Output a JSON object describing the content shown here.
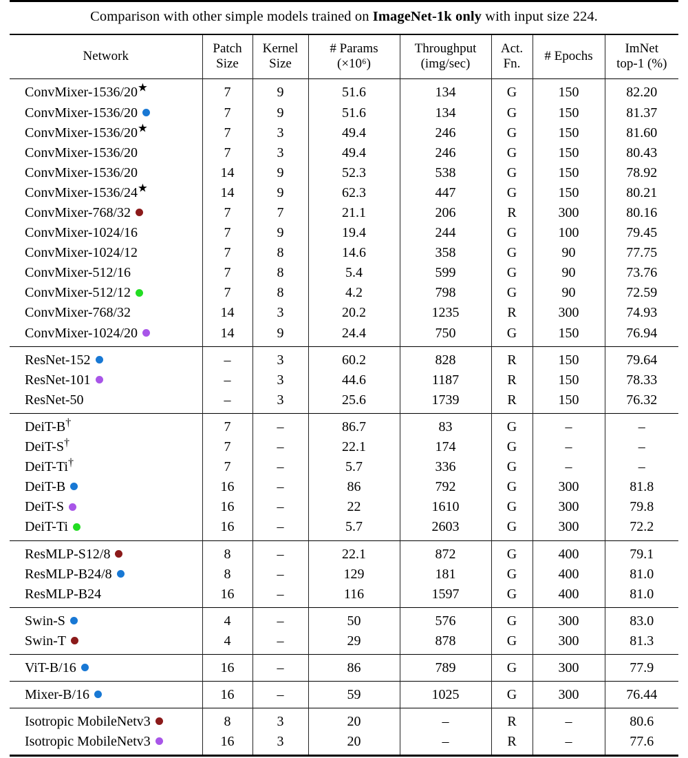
{
  "caption": {
    "prefix": "Comparison with other simple models trained on ",
    "bold": "ImageNet-1k only",
    "suffix": " with input size 224."
  },
  "columns": [
    {
      "id": "network",
      "line1": "Network",
      "line2": ""
    },
    {
      "id": "patch_size",
      "line1": "Patch",
      "line2": "Size"
    },
    {
      "id": "kernel_size",
      "line1": "Kernel",
      "line2": "Size"
    },
    {
      "id": "params",
      "line1": "# Params",
      "line2": "(×10⁶)"
    },
    {
      "id": "throughput",
      "line1": "Throughput",
      "line2": "(img/sec)"
    },
    {
      "id": "act_fn",
      "line1": "Act.",
      "line2": "Fn."
    },
    {
      "id": "epochs",
      "line1": "# Epochs",
      "line2": ""
    },
    {
      "id": "imnet_top1",
      "line1": "ImNet",
      "line2": "top-1 (%)"
    }
  ],
  "marker_colors": {
    "blue": "#1878D4",
    "darkred": "#8B1A1A",
    "green": "#22DD22",
    "purple": "#A855E8"
  },
  "groups": [
    {
      "id": "convmixer",
      "rows": [
        {
          "network": "ConvMixer-1536/20",
          "star": true,
          "dot": null,
          "patch_size": "7",
          "kernel_size": "9",
          "params": "51.6",
          "throughput": "134",
          "act_fn": "G",
          "epochs": "150",
          "imnet_top1": "82.20"
        },
        {
          "network": "ConvMixer-1536/20",
          "star": false,
          "dot": "blue",
          "patch_size": "7",
          "kernel_size": "9",
          "params": "51.6",
          "throughput": "134",
          "act_fn": "G",
          "epochs": "150",
          "imnet_top1": "81.37"
        },
        {
          "network": "ConvMixer-1536/20",
          "star": true,
          "dot": null,
          "patch_size": "7",
          "kernel_size": "3",
          "params": "49.4",
          "throughput": "246",
          "act_fn": "G",
          "epochs": "150",
          "imnet_top1": "81.60"
        },
        {
          "network": "ConvMixer-1536/20",
          "star": false,
          "dot": null,
          "patch_size": "7",
          "kernel_size": "3",
          "params": "49.4",
          "throughput": "246",
          "act_fn": "G",
          "epochs": "150",
          "imnet_top1": "80.43"
        },
        {
          "network": "ConvMixer-1536/20",
          "star": false,
          "dot": null,
          "patch_size": "14",
          "kernel_size": "9",
          "params": "52.3",
          "throughput": "538",
          "act_fn": "G",
          "epochs": "150",
          "imnet_top1": "78.92"
        },
        {
          "network": "ConvMixer-1536/24",
          "star": true,
          "dot": null,
          "patch_size": "14",
          "kernel_size": "9",
          "params": "62.3",
          "throughput": "447",
          "act_fn": "G",
          "epochs": "150",
          "imnet_top1": "80.21"
        },
        {
          "network": "ConvMixer-768/32",
          "star": false,
          "dot": "darkred",
          "patch_size": "7",
          "kernel_size": "7",
          "params": "21.1",
          "throughput": "206",
          "act_fn": "R",
          "epochs": "300",
          "imnet_top1": "80.16"
        },
        {
          "network": "ConvMixer-1024/16",
          "star": false,
          "dot": null,
          "patch_size": "7",
          "kernel_size": "9",
          "params": "19.4",
          "throughput": "244",
          "act_fn": "G",
          "epochs": "100",
          "imnet_top1": "79.45"
        },
        {
          "network": "ConvMixer-1024/12",
          "star": false,
          "dot": null,
          "patch_size": "7",
          "kernel_size": "8",
          "params": "14.6",
          "throughput": "358",
          "act_fn": "G",
          "epochs": "90",
          "imnet_top1": "77.75"
        },
        {
          "network": "ConvMixer-512/16",
          "star": false,
          "dot": null,
          "patch_size": "7",
          "kernel_size": "8",
          "params": "5.4",
          "throughput": "599",
          "act_fn": "G",
          "epochs": "90",
          "imnet_top1": "73.76"
        },
        {
          "network": "ConvMixer-512/12",
          "star": false,
          "dot": "green",
          "patch_size": "7",
          "kernel_size": "8",
          "params": "4.2",
          "throughput": "798",
          "act_fn": "G",
          "epochs": "90",
          "imnet_top1": "72.59"
        },
        {
          "network": "ConvMixer-768/32",
          "star": false,
          "dot": null,
          "patch_size": "14",
          "kernel_size": "3",
          "params": "20.2",
          "throughput": "1235",
          "act_fn": "R",
          "epochs": "300",
          "imnet_top1": "74.93"
        },
        {
          "network": "ConvMixer-1024/20",
          "star": false,
          "dot": "purple",
          "patch_size": "14",
          "kernel_size": "9",
          "params": "24.4",
          "throughput": "750",
          "act_fn": "G",
          "epochs": "150",
          "imnet_top1": "76.94"
        }
      ]
    },
    {
      "id": "resnet",
      "rows": [
        {
          "network": "ResNet-152",
          "star": false,
          "dot": "blue",
          "patch_size": "–",
          "kernel_size": "3",
          "params": "60.2",
          "throughput": "828",
          "act_fn": "R",
          "epochs": "150",
          "imnet_top1": "79.64"
        },
        {
          "network": "ResNet-101",
          "star": false,
          "dot": "purple",
          "patch_size": "–",
          "kernel_size": "3",
          "params": "44.6",
          "throughput": "1187",
          "act_fn": "R",
          "epochs": "150",
          "imnet_top1": "78.33"
        },
        {
          "network": "ResNet-50",
          "star": false,
          "dot": null,
          "patch_size": "–",
          "kernel_size": "3",
          "params": "25.6",
          "throughput": "1739",
          "act_fn": "R",
          "epochs": "150",
          "imnet_top1": "76.32"
        }
      ]
    },
    {
      "id": "deit",
      "rows": [
        {
          "network": "DeiT-B",
          "dagger": true,
          "star": false,
          "dot": null,
          "patch_size": "7",
          "kernel_size": "–",
          "params": "86.7",
          "throughput": "83",
          "act_fn": "G",
          "epochs": "–",
          "imnet_top1": "–"
        },
        {
          "network": "DeiT-S",
          "dagger": true,
          "star": false,
          "dot": null,
          "patch_size": "7",
          "kernel_size": "–",
          "params": "22.1",
          "throughput": "174",
          "act_fn": "G",
          "epochs": "–",
          "imnet_top1": "–"
        },
        {
          "network": "DeiT-Ti",
          "dagger": true,
          "star": false,
          "dot": null,
          "patch_size": "7",
          "kernel_size": "–",
          "params": "5.7",
          "throughput": "336",
          "act_fn": "G",
          "epochs": "–",
          "imnet_top1": "–"
        },
        {
          "network": "DeiT-B",
          "dagger": false,
          "star": false,
          "dot": "blue",
          "patch_size": "16",
          "kernel_size": "–",
          "params": "86",
          "throughput": "792",
          "act_fn": "G",
          "epochs": "300",
          "imnet_top1": "81.8"
        },
        {
          "network": "DeiT-S",
          "dagger": false,
          "star": false,
          "dot": "purple",
          "patch_size": "16",
          "kernel_size": "–",
          "params": "22",
          "throughput": "1610",
          "act_fn": "G",
          "epochs": "300",
          "imnet_top1": "79.8"
        },
        {
          "network": "DeiT-Ti",
          "dagger": false,
          "star": false,
          "dot": "green",
          "patch_size": "16",
          "kernel_size": "–",
          "params": "5.7",
          "throughput": "2603",
          "act_fn": "G",
          "epochs": "300",
          "imnet_top1": "72.2"
        }
      ]
    },
    {
      "id": "resmlp",
      "rows": [
        {
          "network": "ResMLP-S12/8",
          "star": false,
          "dot": "darkred",
          "patch_size": "8",
          "kernel_size": "–",
          "params": "22.1",
          "throughput": "872",
          "act_fn": "G",
          "epochs": "400",
          "imnet_top1": "79.1"
        },
        {
          "network": "ResMLP-B24/8",
          "star": false,
          "dot": "blue",
          "patch_size": "8",
          "kernel_size": "–",
          "params": "129",
          "throughput": "181",
          "act_fn": "G",
          "epochs": "400",
          "imnet_top1": "81.0"
        },
        {
          "network": "ResMLP-B24",
          "star": false,
          "dot": null,
          "patch_size": "16",
          "kernel_size": "–",
          "params": "116",
          "throughput": "1597",
          "act_fn": "G",
          "epochs": "400",
          "imnet_top1": "81.0"
        }
      ]
    },
    {
      "id": "swin",
      "rows": [
        {
          "network": "Swin-S",
          "star": false,
          "dot": "blue",
          "patch_size": "4",
          "kernel_size": "–",
          "params": "50",
          "throughput": "576",
          "act_fn": "G",
          "epochs": "300",
          "imnet_top1": "83.0"
        },
        {
          "network": "Swin-T",
          "star": false,
          "dot": "darkred",
          "patch_size": "4",
          "kernel_size": "–",
          "params": "29",
          "throughput": "878",
          "act_fn": "G",
          "epochs": "300",
          "imnet_top1": "81.3"
        }
      ]
    },
    {
      "id": "vit",
      "rows": [
        {
          "network": "ViT-B/16",
          "star": false,
          "dot": "blue",
          "patch_size": "16",
          "kernel_size": "–",
          "params": "86",
          "throughput": "789",
          "act_fn": "G",
          "epochs": "300",
          "imnet_top1": "77.9"
        }
      ]
    },
    {
      "id": "mixer",
      "rows": [
        {
          "network": "Mixer-B/16",
          "star": false,
          "dot": "blue",
          "patch_size": "16",
          "kernel_size": "–",
          "params": "59",
          "throughput": "1025",
          "act_fn": "G",
          "epochs": "300",
          "imnet_top1": "76.44"
        }
      ]
    },
    {
      "id": "mobilenetv3",
      "rows": [
        {
          "network": "Isotropic MobileNetv3",
          "star": false,
          "dot": "darkred",
          "patch_size": "8",
          "kernel_size": "3",
          "params": "20",
          "throughput": "–",
          "act_fn": "R",
          "epochs": "–",
          "imnet_top1": "80.6"
        },
        {
          "network": "Isotropic MobileNetv3",
          "star": false,
          "dot": "purple",
          "patch_size": "16",
          "kernel_size": "3",
          "params": "20",
          "throughput": "–",
          "act_fn": "R",
          "epochs": "–",
          "imnet_top1": "77.6"
        }
      ]
    }
  ]
}
